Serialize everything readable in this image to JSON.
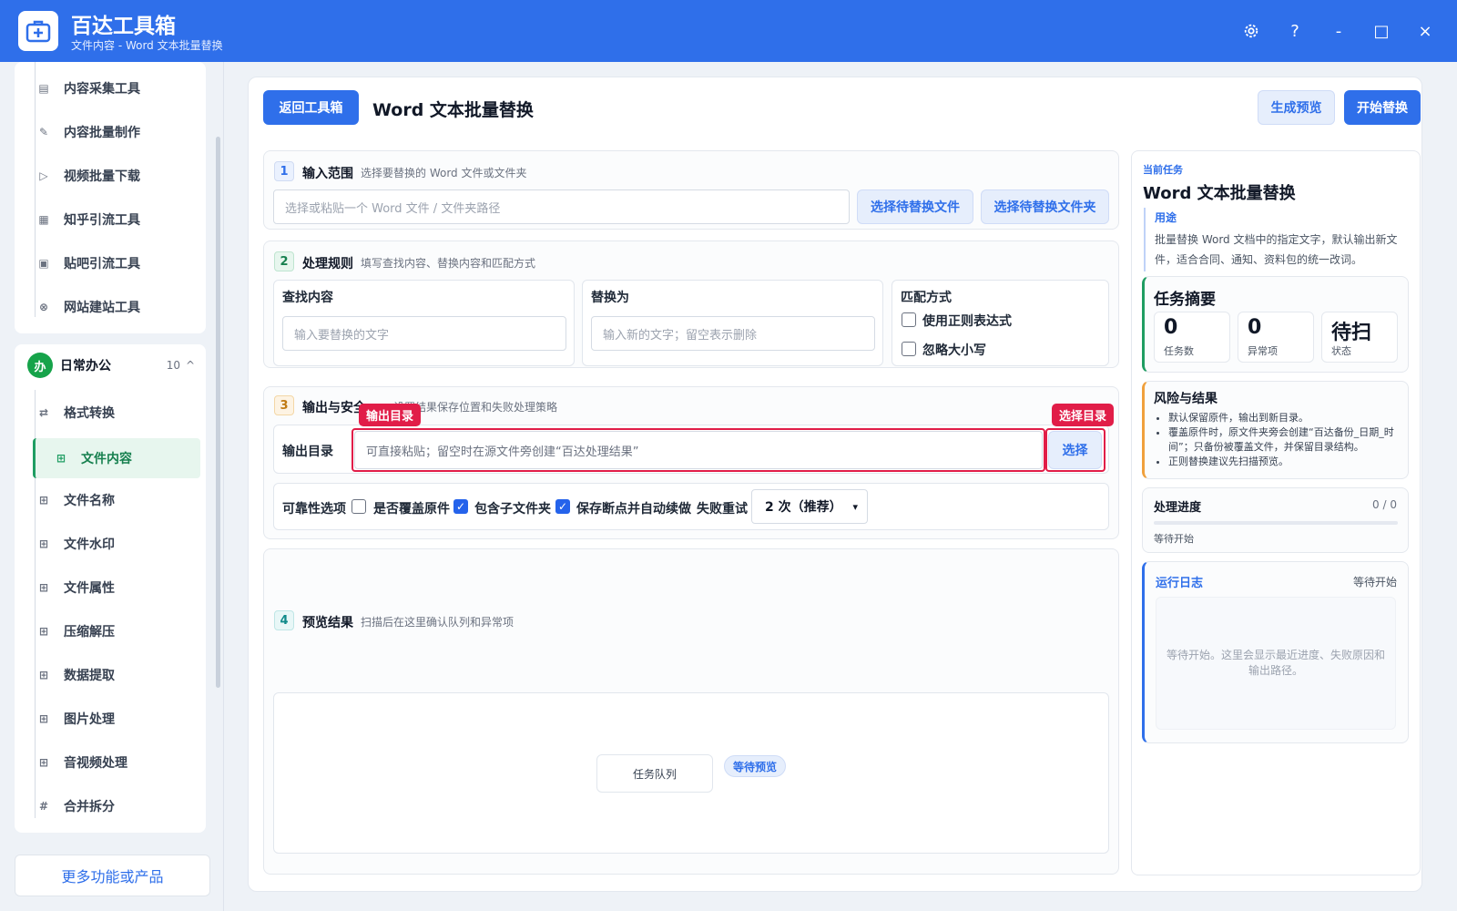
{
  "app": {
    "title": "百达工具箱",
    "subtitle": "文件内容 - Word 文本批量替换",
    "settings_icon": "gear-icon",
    "help_label": "?",
    "minimize_label": "-",
    "maximize_label": "□",
    "close_label": "×"
  },
  "sidebar": {
    "top_items": [
      {
        "icon": "▤",
        "label": "内容采集工具"
      },
      {
        "icon": "✎",
        "label": "内容批量制作"
      },
      {
        "icon": "▷",
        "label": "视频批量下载"
      },
      {
        "icon": "▦",
        "label": "知乎引流工具"
      },
      {
        "icon": "▣",
        "label": "贴吧引流工具"
      },
      {
        "icon": "⊗",
        "label": "网站建站工具"
      }
    ],
    "group": {
      "badge": "办",
      "title": "日常办公",
      "count": "10",
      "toggle": "^"
    },
    "group_items": [
      {
        "icon": "⇄",
        "label": "格式转换"
      },
      {
        "icon": "⊞",
        "label": "文件内容"
      },
      {
        "icon": "⊞",
        "label": "文件名称"
      },
      {
        "icon": "⊞",
        "label": "文件水印"
      },
      {
        "icon": "⊞",
        "label": "文件属性"
      },
      {
        "icon": "⊞",
        "label": "压缩解压"
      },
      {
        "icon": "⊞",
        "label": "数据提取"
      },
      {
        "icon": "⊞",
        "label": "图片处理"
      },
      {
        "icon": "⊞",
        "label": "音视频处理"
      },
      {
        "icon": "#",
        "label": "合并拆分"
      }
    ],
    "more_label": "更多功能或产品"
  },
  "header": {
    "back_label": "返回工具箱",
    "title": "Word 文本批量替换",
    "preview_label": "生成预览",
    "start_label": "开始替换"
  },
  "step1": {
    "num": "1",
    "title": "输入范围",
    "desc": "选择要替换的 Word 文件或文件夹",
    "placeholder": "选择或粘贴一个 Word 文件 / 文件夹路径",
    "pick_file": "选择待替换文件",
    "pick_folder": "选择待替换文件夹"
  },
  "step2": {
    "num": "2",
    "title": "处理规则",
    "desc": "填写查找内容、替换内容和匹配方式",
    "find_label": "查找内容",
    "find_placeholder": "输入要替换的文字",
    "replace_label": "替换为",
    "replace_placeholder": "输入新的文字；留空表示删除",
    "match_label": "匹配方式",
    "regex_label": "使用正则表达式",
    "ignore_case_label": "忽略大小写"
  },
  "step3": {
    "num": "3",
    "title": "输出与安全",
    "desc": "设置结果保存位置和失败处理策略",
    "tag_output": "输出目录",
    "tag_pick": "选择目录",
    "output_label": "输出目录",
    "output_placeholder": "可直接粘贴；留空时在源文件旁创建“百达处理结果”",
    "pick_label": "选择",
    "reliability_label": "可靠性选项",
    "overwrite_label": "是否覆盖原件",
    "subfolder_label": "包含子文件夹",
    "resume_label": "保存断点并自动续做",
    "retry_label": "失败重试",
    "retry_value": "2 次（推荐）"
  },
  "step4": {
    "num": "4",
    "title": "预览结果",
    "desc": "扫描后在这里确认队列和异常项",
    "queue_label": "任务队列",
    "queue_status": "等待预览"
  },
  "panel": {
    "kicker": "当前任务",
    "title": "Word 文本批量替换",
    "purpose_label": "用途",
    "purpose_text": "批量替换 Word 文档中的指定文字，默认输出新文件，适合合同、通知、资料包的统一改词。",
    "summary_title": "任务摘要",
    "stats": [
      {
        "value": "0",
        "label": "任务数"
      },
      {
        "value": "0",
        "label": "异常项"
      },
      {
        "value": "待扫",
        "label": "状态"
      }
    ],
    "risk_title": "风险与结果",
    "risk_items": [
      "默认保留原件，输出到新目录。",
      "覆盖原件时，原文件夹旁会创建“百达备份_日期_时间”；只备份被覆盖文件，并保留目录结构。",
      "正则替换建议先扫描预览。"
    ],
    "progress_title": "处理进度",
    "progress_count": "0 / 0",
    "progress_fraction": 0,
    "progress_status": "等待开始",
    "log_title": "运行日志",
    "log_status": "等待开始",
    "log_text": "等待开始。这里会显示最近进度、失败原因和输出路径。"
  },
  "colors": {
    "brand": "#2f6fea",
    "active": "#1f9d62",
    "alert": "#e11d48",
    "risk": "#f0a03c"
  }
}
